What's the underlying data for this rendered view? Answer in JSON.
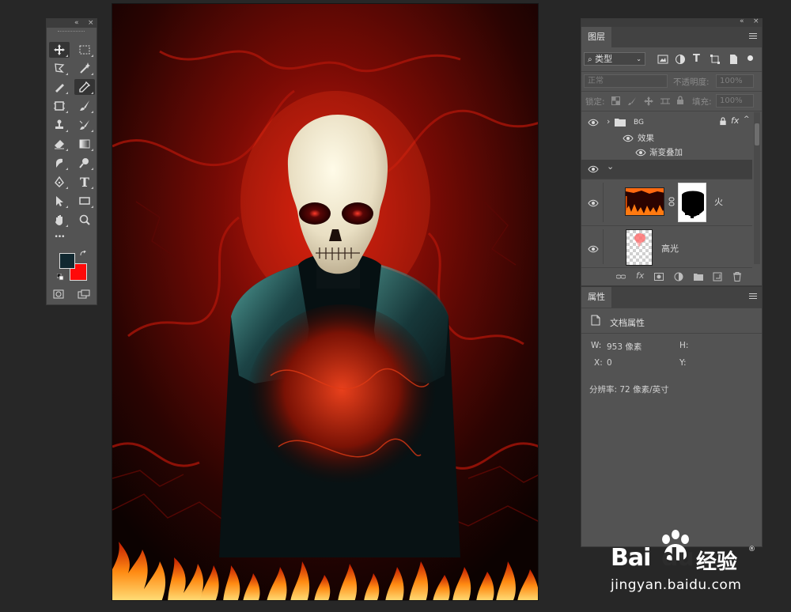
{
  "toolbox": {
    "collapse_glyph": "«",
    "close_glyph": "×",
    "tools": [
      {
        "name": "move-tool-icon",
        "active": true
      },
      {
        "name": "marquee-tool-icon"
      },
      {
        "name": "lasso-tool-icon"
      },
      {
        "name": "magic-wand-tool-icon"
      },
      {
        "name": "brush-small-tool-icon"
      },
      {
        "name": "eyedropper-tool-icon",
        "active": true
      },
      {
        "name": "frame-tool-icon"
      },
      {
        "name": "brush-tool-icon"
      },
      {
        "name": "clone-stamp-tool-icon"
      },
      {
        "name": "history-brush-tool-icon"
      },
      {
        "name": "eraser-tool-icon"
      },
      {
        "name": "gradient-tool-icon"
      },
      {
        "name": "smudge-tool-icon"
      },
      {
        "name": "dodge-tool-icon"
      },
      {
        "name": "pen-tool-icon"
      },
      {
        "name": "type-tool-icon"
      },
      {
        "name": "path-selection-tool-icon"
      },
      {
        "name": "rectangle-tool-icon"
      },
      {
        "name": "hand-tool-icon"
      },
      {
        "name": "zoom-tool-icon"
      },
      {
        "name": "more-tools-icon"
      }
    ],
    "type_glyph": "T",
    "more_glyph": "•••",
    "colors": {
      "foreground": "#102830",
      "background": "#ff0a0a"
    }
  },
  "layers_panel": {
    "tab_label": "图层",
    "filter_kind": "类型",
    "blend_mode": "正常",
    "opacity_label": "不透明度:",
    "opacity_value": "100%",
    "lock_label": "锁定:",
    "fill_label": "填充:",
    "fill_value": "100%",
    "layers": [
      {
        "name": "BG",
        "type": "group",
        "effects_label": "效果",
        "effect": "渐变叠加",
        "fx": "fx"
      },
      {
        "name": "",
        "type": "group-expanded"
      },
      {
        "name": "火",
        "type": "layer-with-mask"
      },
      {
        "name": "高光",
        "type": "layer"
      }
    ],
    "caret_glyph": "›",
    "expand_glyph": "⌄"
  },
  "properties_panel": {
    "tab_label": "属性",
    "doc_label": "文档属性",
    "w_label": "W:",
    "w_value": "953 像素",
    "h_label": "H:",
    "x_label": "X:",
    "x_value": "0",
    "y_label": "Y:",
    "resolution": "分辨率: 72 像素/英寸"
  },
  "watermark": {
    "brand_left": "Bai",
    "brand_right": "du",
    "brand_cn": "经验",
    "url": "jingyan.baidu.com",
    "reg": "®"
  }
}
